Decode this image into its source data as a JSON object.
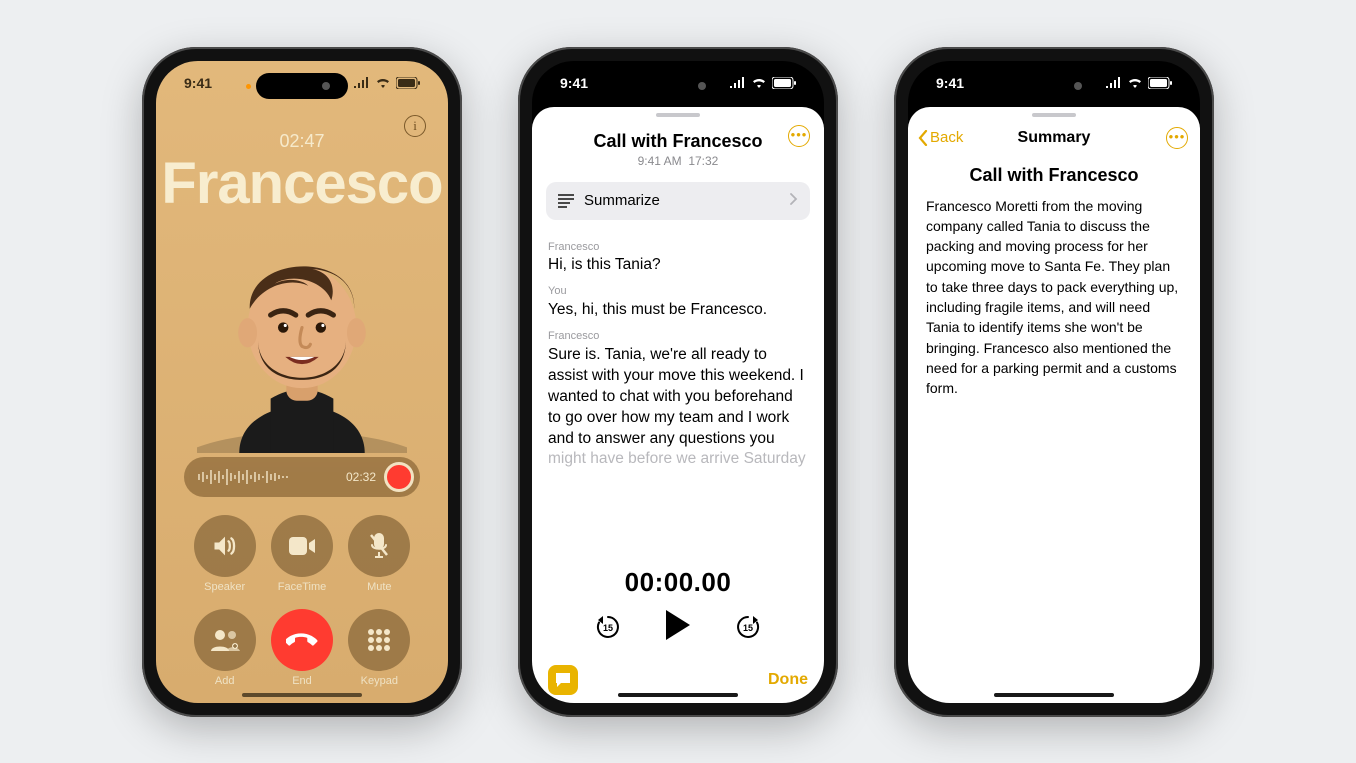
{
  "status": {
    "time": "9:41"
  },
  "call": {
    "duration": "02:47",
    "caller": "Francesco",
    "recording_time": "02:32",
    "buttons": {
      "speaker": "Speaker",
      "facetime": "FaceTime",
      "mute": "Mute",
      "add": "Add",
      "end": "End",
      "keypad": "Keypad"
    }
  },
  "transcript": {
    "title": "Call with Francesco",
    "subtitle_time": "9:41 AM",
    "subtitle_duration": "17:32",
    "summarize_label": "Summarize",
    "lines": [
      {
        "speaker": "Francesco",
        "text": "Hi, is this Tania?"
      },
      {
        "speaker": "You",
        "text": "Yes, hi, this must be Francesco."
      },
      {
        "speaker": "Francesco",
        "text": "Sure is. Tania, we're all ready to assist with your move this weekend. I wanted to chat with you beforehand to go over how my team and I work and to answer any questions you might have before we arrive Saturday"
      }
    ],
    "playback_time": "00:00.00",
    "skip_seconds": "15",
    "done_label": "Done"
  },
  "summary": {
    "back_label": "Back",
    "nav_title": "Summary",
    "title": "Call with Francesco",
    "body": "Francesco Moretti from the moving company called Tania to discuss the packing and moving process for her upcoming move to Santa Fe. They plan to take three days to pack everything up, including fragile items, and will need Tania to identify items she won't be bringing. Francesco also mentioned the need for a parking permit and a customs form."
  }
}
